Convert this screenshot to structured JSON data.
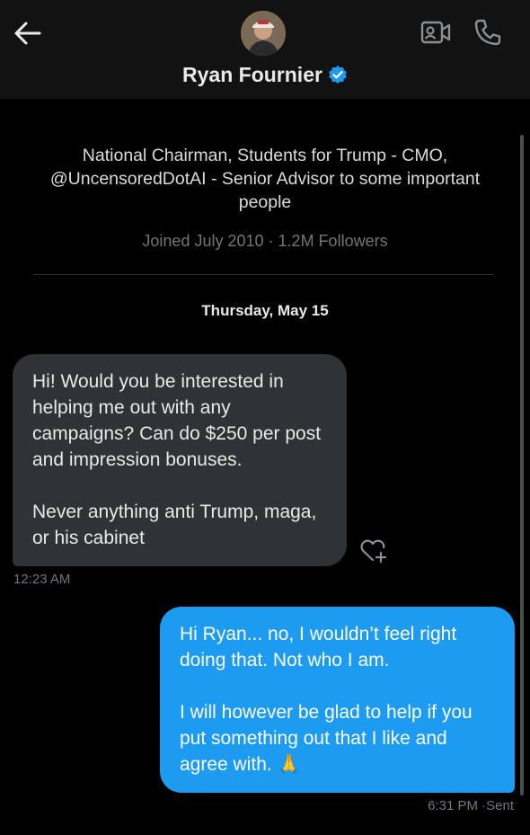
{
  "header": {
    "name": "Ryan Fournier",
    "back_icon": "arrow-left-icon",
    "video_icon": "video-camera-icon",
    "call_icon": "phone-icon",
    "verified_icon": "verified-badge-icon"
  },
  "profile": {
    "bio": "National Chairman, Students for Trump - CMO, @UncensoredDotAI - Senior Advisor to some important people",
    "joined": "Joined July 2010",
    "separator": "·",
    "followers": "1.2M Followers"
  },
  "conversation": {
    "date": "Thursday, May 15",
    "messages": [
      {
        "direction": "incoming",
        "paragraphs": [
          "Hi! Would you be interested in helping me out with any campaigns? Can do $250 per post and impression bonuses.",
          "Never anything anti Trump, maga, or his cabinet"
        ],
        "time": "12:23 AM"
      },
      {
        "direction": "outgoing",
        "paragraphs": [
          "Hi Ryan... no, I wouldn’t feel right doing that. Not who I am.",
          "I will however be glad to help if you put something out that I like and agree with. 🙏"
        ],
        "time": "6:31 PM",
        "status": "Sent"
      }
    ]
  },
  "colors": {
    "background": "#000000",
    "header_bg": "#121212",
    "incoming_bubble": "#2f3336",
    "outgoing_bubble": "#1d9bf0",
    "muted_text": "#71767b",
    "verified": "#1d9bf0"
  }
}
